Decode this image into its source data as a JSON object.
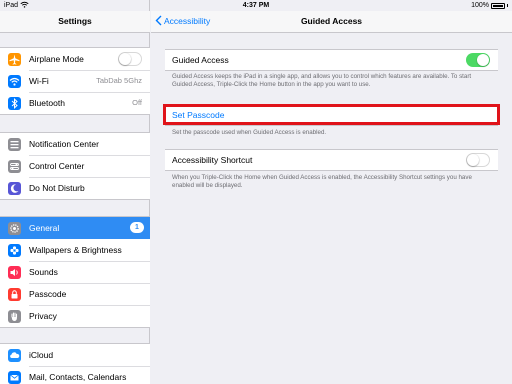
{
  "status_bar": {
    "device": "iPad",
    "time": "4:37 PM",
    "battery": "100%"
  },
  "sidebar": {
    "title": "Settings",
    "groups": [
      {
        "items": [
          {
            "label": "Airplane Mode",
            "icon": "airplane-icon",
            "color": "#ff9500",
            "toggle": "off"
          },
          {
            "label": "Wi-Fi",
            "icon": "wifi-icon",
            "color": "#007aff",
            "value": "TabDab 5Ghz"
          },
          {
            "label": "Bluetooth",
            "icon": "bluetooth-icon",
            "color": "#007aff",
            "value": "Off"
          }
        ]
      },
      {
        "items": [
          {
            "label": "Notification Center",
            "icon": "notification-center-icon",
            "color": "#8e8e93"
          },
          {
            "label": "Control Center",
            "icon": "control-center-icon",
            "color": "#8e8e93"
          },
          {
            "label": "Do Not Disturb",
            "icon": "moon-icon",
            "color": "#5856d6"
          }
        ]
      },
      {
        "items": [
          {
            "label": "General",
            "icon": "gear-icon",
            "color": "#8e8e93",
            "badge": "1",
            "selected": true
          },
          {
            "label": "Wallpapers & Brightness",
            "icon": "flower-icon",
            "color": "#007aff"
          },
          {
            "label": "Sounds",
            "icon": "speaker-icon",
            "color": "#ff2d55"
          },
          {
            "label": "Passcode",
            "icon": "lock-icon",
            "color": "#ff3b30"
          },
          {
            "label": "Privacy",
            "icon": "hand-icon",
            "color": "#8e8e93"
          }
        ]
      },
      {
        "items": [
          {
            "label": "iCloud",
            "icon": "cloud-icon",
            "color": "#1e90ff"
          },
          {
            "label": "Mail, Contacts, Calendars",
            "icon": "mail-icon",
            "color": "#007aff"
          }
        ]
      }
    ]
  },
  "content": {
    "back_label": "Accessibility",
    "title": "Guided Access",
    "guided_access_label": "Guided Access",
    "guided_access_state": "on",
    "guided_access_note": "Guided Access keeps the iPad in a single app, and allows you to control which features are available. To start Guided Access, Triple-Click the Home button in the app you want to use.",
    "set_passcode_label": "Set Passcode",
    "set_passcode_note": "Set the passcode used when Guided Access is enabled.",
    "shortcut_label": "Accessibility Shortcut",
    "shortcut_state": "off",
    "shortcut_note": "When you Triple-Click the Home when Guided Access is enabled, the Accessibility Shortcut settings you have enabled will be displayed."
  },
  "colors": {
    "accent": "#007aff",
    "toggle_on": "#4cd964",
    "selected_row": "#2f8cf3",
    "highlight": "#e0131a"
  }
}
